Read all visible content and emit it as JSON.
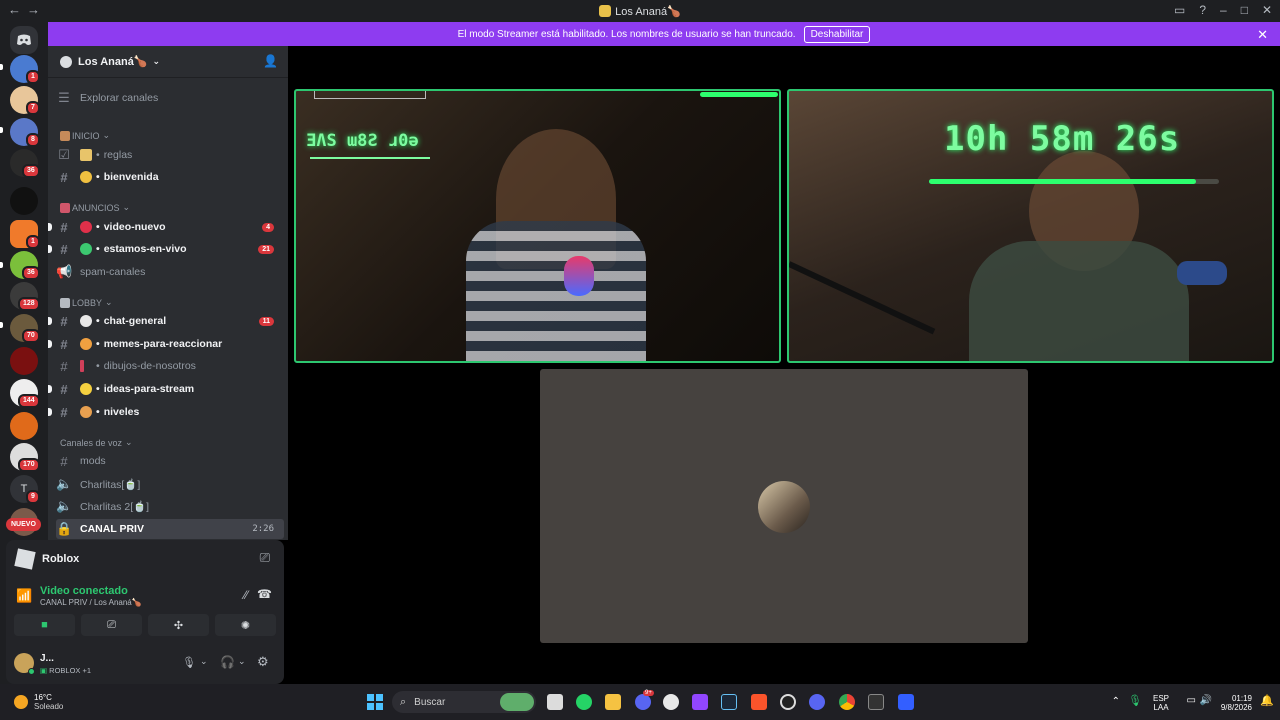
{
  "window": {
    "title": "Los Ananá",
    "title_emoji": "🍗"
  },
  "banner": {
    "text": "El modo Streamer está habilitado. Los nombres de usuario se han truncado.",
    "button": "Deshabilitar"
  },
  "rail": {
    "badges": [
      "1",
      "7",
      "8",
      "36",
      "1",
      "36",
      "128",
      "70",
      "144",
      "170",
      "9"
    ],
    "text_server": "T",
    "nuevo": "NUEVO"
  },
  "guild": {
    "name": "Los Ananá",
    "emoji": "🍗"
  },
  "explore": "Explorar canales",
  "categories": {
    "inicio": "INICIO",
    "anuncios": "ANUNCIOS",
    "lobby": "LOBBY",
    "voz": "Canales de voz"
  },
  "channels": {
    "reglas": "reglas",
    "bienvenida": "bienvenida",
    "video_nuevo": "video-nuevo",
    "video_nuevo_count": "4",
    "estamos_en_vivo": "estamos-en-vivo",
    "estamos_en_vivo_count": "21",
    "spam_canales": "spam-canales",
    "chat_general": "chat-general",
    "chat_general_count": "11",
    "memes": "memes-para-reaccionar",
    "dibujos": "dibujos-de-nosotros",
    "ideas": "ideas-para-stream",
    "niveles": "niveles",
    "mods": "mods",
    "charlitas": "Charlitas[🍵]",
    "charlitas2": "Charlitas 2[🍵]",
    "canal_priv": "CANAL PRIV",
    "canal_priv_timer": "2:26"
  },
  "activity": {
    "name": "Roblox"
  },
  "voice": {
    "status": "Video conectado",
    "location": "CANAL PRIV / Los Ananá🍗"
  },
  "user": {
    "name": "J...",
    "activity": "ROBLOX +1"
  },
  "stage": {
    "overlay1": "ƎɅS ɯ8Ƨ ɹ0ǝ",
    "overlay2": "10h 58m 26s"
  },
  "taskbar": {
    "temp": "16°C",
    "weather": "Soleado",
    "search": "Buscar",
    "lang1": "ESP",
    "lang2": "LAA",
    "time": "01:19",
    "date": "9/8/2026",
    "discord_badge": "9+"
  },
  "colors": {
    "accent_green": "#2dc770",
    "banner_purple": "#8e3cf0",
    "badge_red": "#da373c"
  }
}
